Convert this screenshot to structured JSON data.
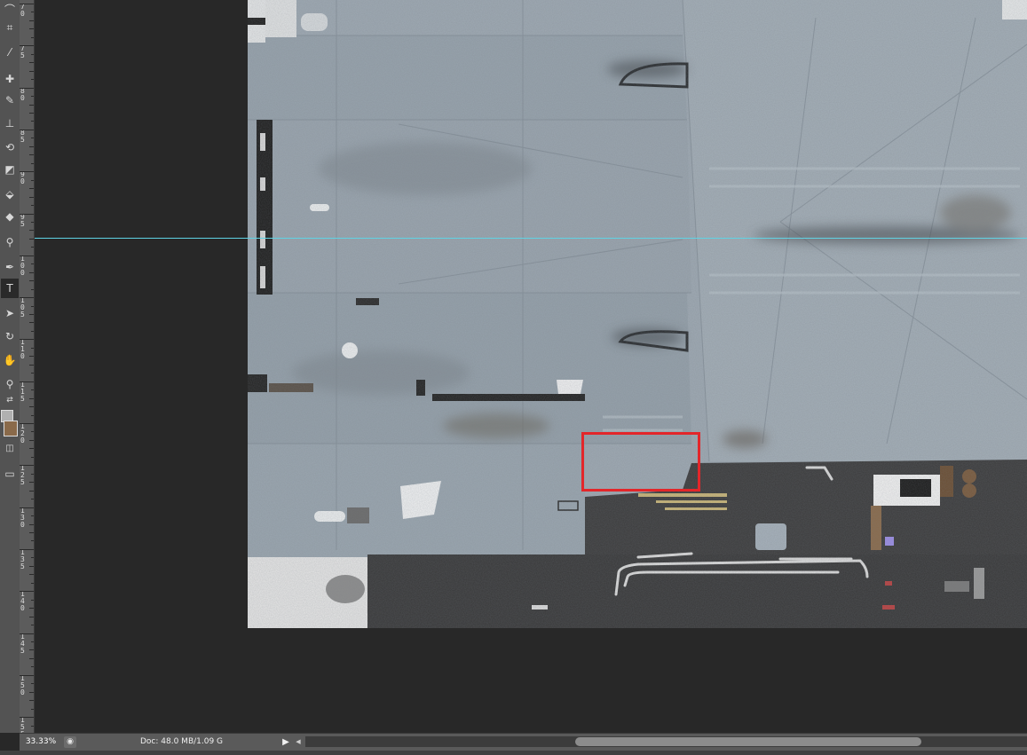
{
  "toolbar": {
    "tools": [
      {
        "name": "lasso-tool-icon",
        "glyph": "⌒"
      },
      {
        "name": "crop-tool-icon",
        "glyph": "⌗"
      },
      {
        "name": "eyedropper-tool-icon",
        "glyph": "⁄"
      },
      {
        "name": "healing-brush-tool-icon",
        "glyph": "✚"
      },
      {
        "name": "brush-tool-icon",
        "glyph": "✎"
      },
      {
        "name": "clone-stamp-tool-icon",
        "glyph": "⊥"
      },
      {
        "name": "history-brush-tool-icon",
        "glyph": "⟲"
      },
      {
        "name": "eraser-tool-icon",
        "glyph": "◩"
      },
      {
        "name": "paint-bucket-tool-icon",
        "glyph": "⬙"
      },
      {
        "name": "blur-tool-icon",
        "glyph": "◆"
      },
      {
        "name": "dodge-tool-icon",
        "glyph": "⚲"
      },
      {
        "name": "pen-tool-icon",
        "glyph": "✒"
      },
      {
        "name": "type-tool-icon",
        "glyph": "T",
        "active": true
      },
      {
        "name": "path-selection-tool-icon",
        "glyph": "➤"
      },
      {
        "name": "rotate-view-tool-icon",
        "glyph": "↻"
      },
      {
        "name": "hand-tool-icon",
        "glyph": "✋"
      },
      {
        "name": "zoom-tool-icon",
        "glyph": "⚲"
      }
    ],
    "foreground_color": "#b0b0b0",
    "background_color": "#8a6a4a"
  },
  "ruler": {
    "ticks": [
      "70",
      "75",
      "80",
      "85",
      "90",
      "95",
      "100",
      "105",
      "110",
      "115",
      "120",
      "125",
      "130",
      "135",
      "140",
      "145",
      "150",
      "155"
    ]
  },
  "status": {
    "zoom": "33.33%",
    "doc_info": "Doc: 48.0 MB/1.09 G",
    "arrow": "▶",
    "scroll_left": "◀"
  },
  "colors": {
    "guide": "#5fd3e4",
    "selection": "#e3262a"
  }
}
